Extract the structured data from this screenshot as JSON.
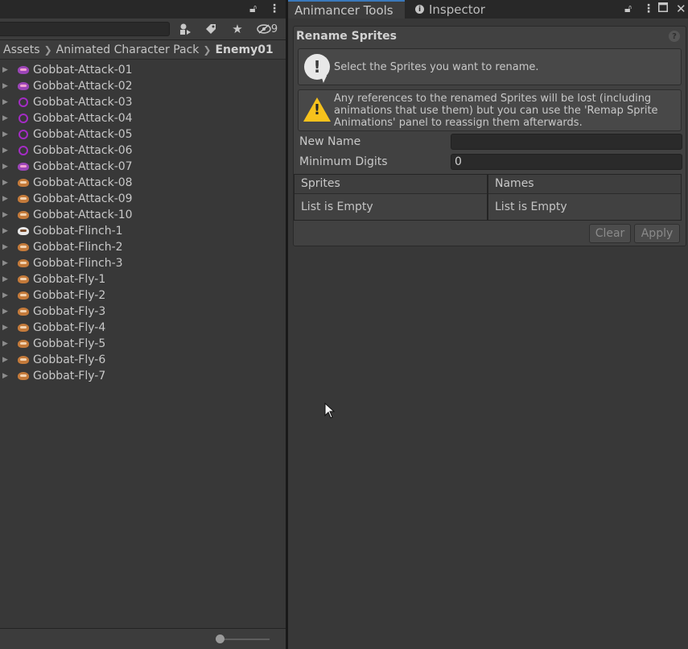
{
  "project": {
    "hidden_count": "9",
    "breadcrumb": [
      "Assets",
      "Animated Character Pack",
      "Enemy01"
    ],
    "assets": [
      {
        "name": "Gobbat-Attack-01",
        "thumb": "bat-purple"
      },
      {
        "name": "Gobbat-Attack-02",
        "thumb": "bat-purple"
      },
      {
        "name": "Gobbat-Attack-03",
        "thumb": "ring"
      },
      {
        "name": "Gobbat-Attack-04",
        "thumb": "ring"
      },
      {
        "name": "Gobbat-Attack-05",
        "thumb": "ring"
      },
      {
        "name": "Gobbat-Attack-06",
        "thumb": "ring"
      },
      {
        "name": "Gobbat-Attack-07",
        "thumb": "bat-purple"
      },
      {
        "name": "Gobbat-Attack-08",
        "thumb": "bat"
      },
      {
        "name": "Gobbat-Attack-09",
        "thumb": "bat"
      },
      {
        "name": "Gobbat-Attack-10",
        "thumb": "bat"
      },
      {
        "name": "Gobbat-Flinch-1",
        "thumb": "bat-flinch"
      },
      {
        "name": "Gobbat-Flinch-2",
        "thumb": "bat"
      },
      {
        "name": "Gobbat-Flinch-3",
        "thumb": "bat"
      },
      {
        "name": "Gobbat-Fly-1",
        "thumb": "bat"
      },
      {
        "name": "Gobbat-Fly-2",
        "thumb": "bat"
      },
      {
        "name": "Gobbat-Fly-3",
        "thumb": "bat"
      },
      {
        "name": "Gobbat-Fly-4",
        "thumb": "bat"
      },
      {
        "name": "Gobbat-Fly-5",
        "thumb": "bat"
      },
      {
        "name": "Gobbat-Fly-6",
        "thumb": "bat"
      },
      {
        "name": "Gobbat-Fly-7",
        "thumb": "bat"
      }
    ],
    "zoom_level": 0.05
  },
  "tabs": {
    "animancer": "Animancer Tools",
    "inspector": "Inspector"
  },
  "rename": {
    "title": "Rename Sprites",
    "info_text": "Select the Sprites you want to rename.",
    "warning_text": "Any references to the renamed Sprites will be lost (including animations that use them) but you can use the 'Remap Sprite Animations' panel to reassign them afterwards.",
    "new_name_label": "New Name",
    "new_name_value": "",
    "min_digits_label": "Minimum Digits",
    "min_digits_value": "0",
    "sprites_header": "Sprites",
    "names_header": "Names",
    "sprites_empty": "List is Empty",
    "names_empty": "List is Empty",
    "clear_label": "Clear",
    "apply_label": "Apply"
  },
  "colors": {
    "accent": "#3a79bb",
    "warning": "#f7c21c",
    "ring": "#a42cc4"
  }
}
